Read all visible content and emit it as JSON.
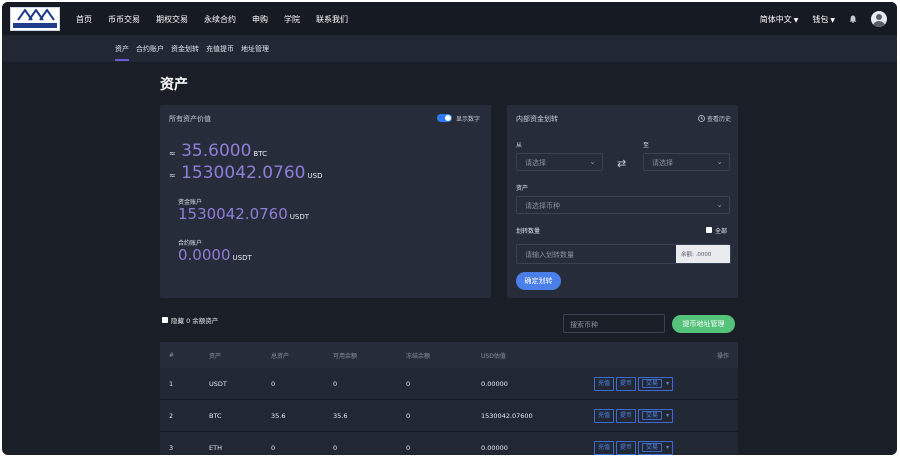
{
  "header": {
    "nav": [
      "首页",
      "币币交易",
      "期权交易",
      "永续合约",
      "申购",
      "学院",
      "联系我们"
    ],
    "language": "简体中文",
    "wallet": "钱包"
  },
  "subnav": [
    "资产",
    "合约账户",
    "资金划转",
    "充值提币",
    "地址管理"
  ],
  "page_title": "资产",
  "assets_card": {
    "title": "所有资产价值",
    "toggle_label": "显示数字",
    "btc_value": "35.6000",
    "btc_unit": "BTC",
    "usd_value": "1530042.0760",
    "usd_unit": "USD",
    "fund_account_label": "资金账户",
    "fund_account_value": "1530042.0760",
    "fund_account_unit": "USDT",
    "contract_account_label": "合约账户",
    "contract_account_value": "0.0000",
    "contract_account_unit": "USDT",
    "approx": "≈"
  },
  "transfer_card": {
    "title": "内部资金划转",
    "history": "查看历史",
    "from_label": "从",
    "to_label": "至",
    "from_placeholder": "请选择",
    "to_placeholder": "请选择",
    "asset_label": "资产",
    "asset_placeholder": "请选择币种",
    "amount_label": "划转数量",
    "all_label": "全部",
    "amount_placeholder": "请输入划转数量",
    "balance": "余额: .0000",
    "confirm": "确定划转"
  },
  "controls": {
    "hide_zero": "隐藏 0 余额资产",
    "search_placeholder": "搜索币种",
    "address_button": "提币地址管理"
  },
  "table": {
    "columns": [
      "#",
      "资产",
      "总资产",
      "可用余额",
      "冻结余额",
      "USD估值",
      "操作"
    ],
    "rows": [
      {
        "idx": "1",
        "asset": "USDT",
        "total": "0",
        "available": "0",
        "frozen": "0",
        "usd": "0.00000"
      },
      {
        "idx": "2",
        "asset": "BTC",
        "total": "35.6",
        "available": "35.6",
        "frozen": "0",
        "usd": "1530042.07600"
      },
      {
        "idx": "3",
        "asset": "ETH",
        "total": "0",
        "available": "0",
        "frozen": "0",
        "usd": "0.00000"
      }
    ],
    "actions": [
      "充值",
      "提币",
      "交易"
    ]
  }
}
